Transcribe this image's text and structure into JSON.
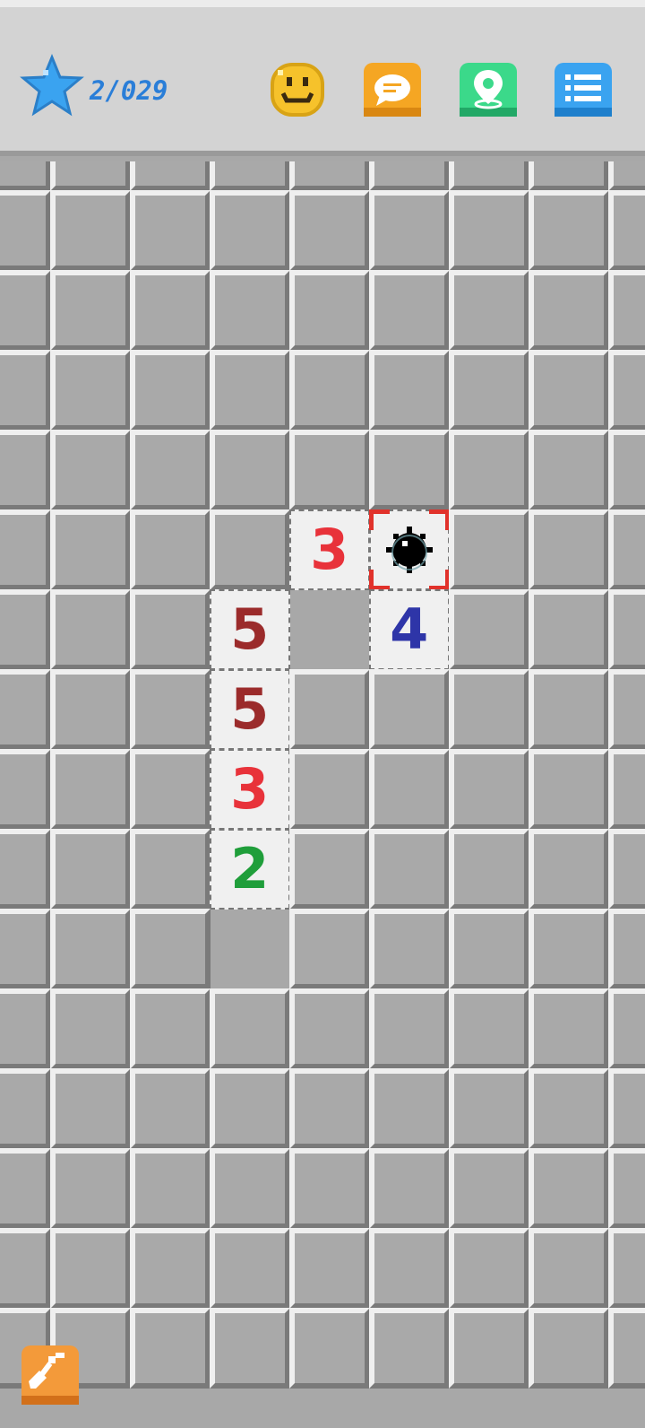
{
  "header": {
    "progress_text": "2/029",
    "star_icon": "star-icon",
    "buttons": [
      {
        "name": "smiley-button",
        "icon": "smiley-icon",
        "color": "#f6c22b"
      },
      {
        "name": "chat-button",
        "icon": "chat-bubble-icon",
        "color": "#f5a623"
      },
      {
        "name": "map-location-button",
        "icon": "location-pin-icon",
        "color": "#3bd98a"
      },
      {
        "name": "menu-button",
        "icon": "list-icon",
        "color": "#3aa3f0"
      }
    ]
  },
  "board": {
    "columns": 8,
    "rows": 16,
    "revealed": [
      {
        "row": 5,
        "col": 3,
        "type": "number",
        "value": "3",
        "color": "#e8323a"
      },
      {
        "row": 5,
        "col": 4,
        "type": "mine"
      },
      {
        "row": 6,
        "col": 2,
        "type": "number",
        "value": "5",
        "color": "#9b2b2b"
      },
      {
        "row": 6,
        "col": 3,
        "type": "mine"
      },
      {
        "row": 6,
        "col": 4,
        "type": "number",
        "value": "4",
        "color": "#2e35a8"
      },
      {
        "row": 7,
        "col": 2,
        "type": "number",
        "value": "5",
        "color": "#9b2b2b"
      },
      {
        "row": 8,
        "col": 2,
        "type": "number",
        "value": "3",
        "color": "#e8323a"
      },
      {
        "row": 9,
        "col": 2,
        "type": "number",
        "value": "2",
        "color": "#1f9e3a"
      },
      {
        "row": 10,
        "col": 2,
        "type": "mine"
      }
    ]
  },
  "tool": {
    "name": "shovel-tool",
    "icon": "shovel-icon",
    "color": "#f39a3a"
  }
}
